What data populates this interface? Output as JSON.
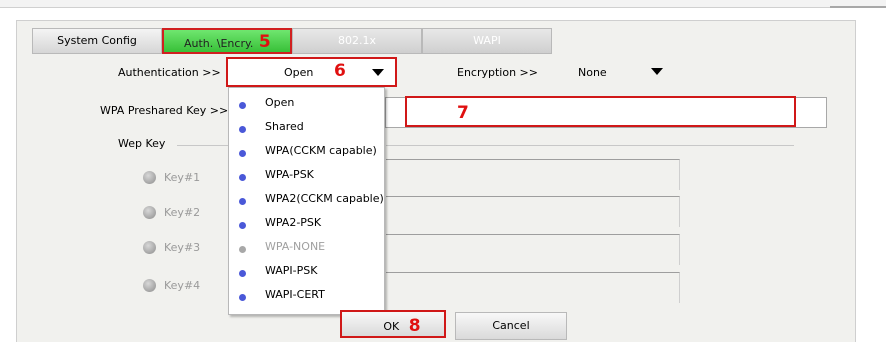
{
  "tabs": [
    {
      "label": "System Config"
    },
    {
      "label": "Auth. \\Encry."
    },
    {
      "label": "802.1x"
    },
    {
      "label": "WAPI"
    }
  ],
  "annotations": [
    "5",
    "6",
    "7",
    "8"
  ],
  "auth": {
    "label": "Authentication >>",
    "selected": "Open"
  },
  "encryption": {
    "label": "Encryption >>",
    "selected": "None"
  },
  "wpa": {
    "label": "WPA Preshared Key >>",
    "value": ""
  },
  "wep": {
    "label": "Wep Key"
  },
  "keys": [
    {
      "label": "Key#1"
    },
    {
      "label": "Key#2"
    },
    {
      "label": "Key#3"
    },
    {
      "label": "Key#4"
    }
  ],
  "auth_options": [
    {
      "label": "Open",
      "disabled": false
    },
    {
      "label": "Shared",
      "disabled": false
    },
    {
      "label": "WPA(CCKM capable)",
      "disabled": false
    },
    {
      "label": "WPA-PSK",
      "disabled": false
    },
    {
      "label": "WPA2(CCKM capable)",
      "disabled": false
    },
    {
      "label": "WPA2-PSK",
      "disabled": false
    },
    {
      "label": "WPA-NONE",
      "disabled": true
    },
    {
      "label": "WAPI-PSK",
      "disabled": false
    },
    {
      "label": "WAPI-CERT",
      "disabled": false
    }
  ],
  "buttons": {
    "ok": "OK",
    "cancel": "Cancel"
  },
  "colors": {
    "highlight": "#d01818",
    "active_tab": "#4cd04c",
    "bullet": "#4a58d8"
  }
}
